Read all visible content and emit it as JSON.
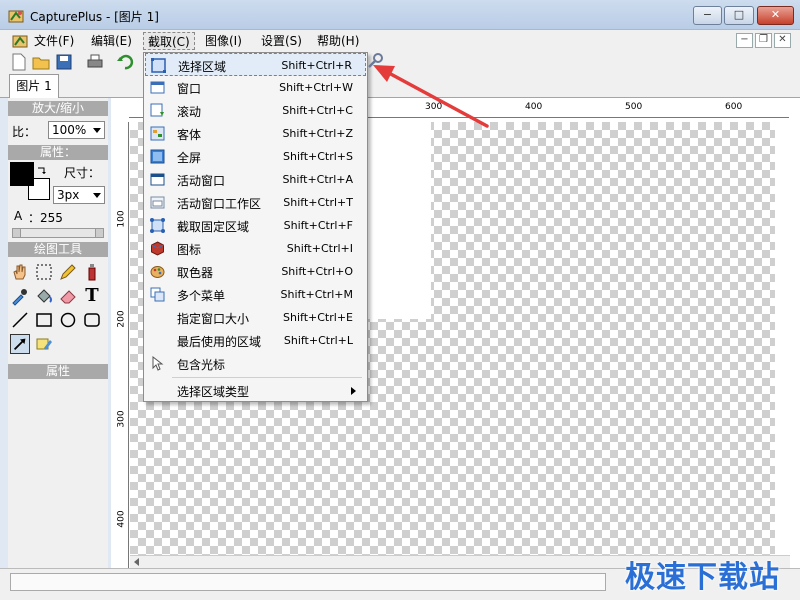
{
  "window": {
    "title": "CapturePlus - [图片 1]",
    "minimize": "−",
    "maximize": "□",
    "close": "✕"
  },
  "menubar": [
    "文件(F)",
    "编辑(E)",
    "截取(C)",
    "图像(I)",
    "设置(S)",
    "帮助(H)"
  ],
  "tabs": [
    "图片 1"
  ],
  "left_panel": {
    "zoom_header": "放大/缩小",
    "zoom_label": "比：",
    "zoom_value": "100%",
    "props_header": "属性：",
    "size_label": "尺寸：",
    "size_value": "3px",
    "alpha_label": "A",
    "alpha_value": "：255",
    "tools_header": "绘图工具",
    "attr_header": "属性",
    "colors": {
      "primary": "#000000",
      "secondary": "#ffffff"
    }
  },
  "ruler": {
    "h": [
      "300",
      "400",
      "500",
      "600"
    ],
    "v": [
      "100",
      "200",
      "300",
      "400"
    ]
  },
  "capture_menu": [
    {
      "icon": "select-region-icon",
      "label": "选择区域",
      "shortcut": "Shift+Ctrl+R"
    },
    {
      "icon": "window-icon",
      "label": "窗口",
      "shortcut": "Shift+Ctrl+W"
    },
    {
      "icon": "scroll-icon",
      "label": "滚动",
      "shortcut": "Shift+Ctrl+C"
    },
    {
      "icon": "client-area-icon",
      "label": "客体",
      "shortcut": "Shift+Ctrl+Z"
    },
    {
      "icon": "fullscreen-icon",
      "label": "全屏",
      "shortcut": "Shift+Ctrl+S"
    },
    {
      "icon": "active-window-icon",
      "label": "活动窗口",
      "shortcut": "Shift+Ctrl+A"
    },
    {
      "icon": "active-window-work-area-icon",
      "label": "活动窗口工作区",
      "shortcut": "Shift+Ctrl+T"
    },
    {
      "icon": "fixed-region-icon",
      "label": "截取固定区域",
      "shortcut": "Shift+Ctrl+F"
    },
    {
      "icon": "icon-capture-icon",
      "label": "图标",
      "shortcut": "Shift+Ctrl+I"
    },
    {
      "icon": "color-picker-icon",
      "label": "取色器",
      "shortcut": "Shift+Ctrl+O"
    },
    {
      "icon": "multi-menu-icon",
      "label": "多个菜单",
      "shortcut": "Shift+Ctrl+M"
    },
    {
      "icon": "",
      "label": "指定窗口大小",
      "shortcut": "Shift+Ctrl+E"
    },
    {
      "icon": "",
      "label": "最后使用的区域",
      "shortcut": "Shift+Ctrl+L"
    },
    {
      "icon": "cursor-icon",
      "label": "包含光标",
      "shortcut": ""
    }
  ],
  "capture_menu_tail": {
    "label": "选择区域类型"
  },
  "watermark": "极速下载站",
  "accent": "#e43b3b"
}
